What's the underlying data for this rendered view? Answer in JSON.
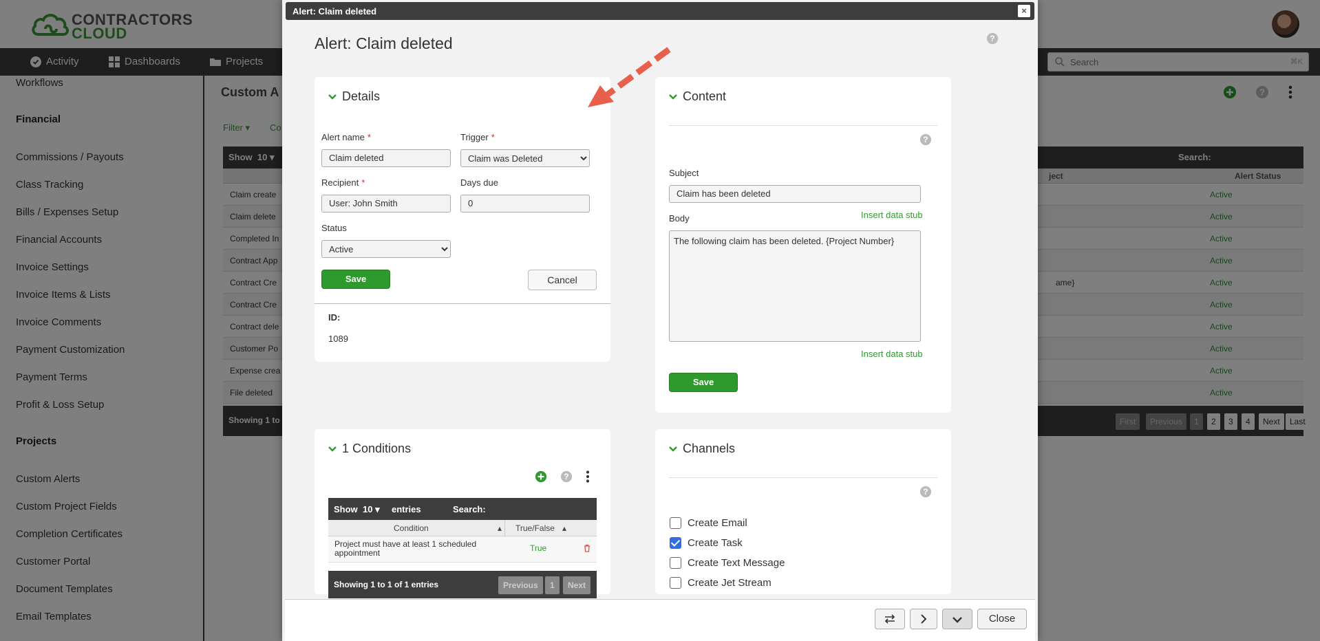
{
  "brand": {
    "line1": "CONTRACTORS",
    "line2": "CLOUD"
  },
  "nav": {
    "items": [
      {
        "label": "Activity",
        "icon": "check-circle-icon"
      },
      {
        "label": "Dashboards",
        "icon": "grid-icon"
      },
      {
        "label": "Projects",
        "icon": "folder-icon"
      }
    ],
    "search_placeholder": "Search",
    "search_shortcut": "⌘K"
  },
  "sidebar": {
    "top_item": "Workflows",
    "financial_heading": "Financial",
    "financial_items": [
      "Commissions / Payouts",
      "Class Tracking",
      "Bills / Expenses Setup",
      "Financial Accounts",
      "Invoice Settings",
      "Invoice Items & Lists",
      "Invoice Comments",
      "Payment Customization",
      "Payment Terms",
      "Profit & Loss Setup"
    ],
    "projects_heading": "Projects",
    "projects_items": [
      "Custom Alerts",
      "Custom Project Fields",
      "Completion Certificates",
      "Customer Portal",
      "Document Templates",
      "Email Templates"
    ]
  },
  "background_page": {
    "title": "Custom A",
    "filter_label": "Filter",
    "co_label": "Co",
    "show_label": "Show",
    "show_value": "10",
    "search_label": "Search:",
    "col_project": "ject",
    "col_status": "Alert Status",
    "rows": [
      {
        "name": "Claim create",
        "extra": "",
        "status": "Active"
      },
      {
        "name": "Claim delete",
        "extra": "",
        "status": "Active"
      },
      {
        "name": "Completed In",
        "extra": "",
        "status": "Active"
      },
      {
        "name": "Contract App",
        "extra": "",
        "status": "Active"
      },
      {
        "name": "Contract Cre",
        "extra": "ame}",
        "status": "Active"
      },
      {
        "name": "Contract Cre",
        "extra": "",
        "status": "Active"
      },
      {
        "name": "Contract dele",
        "extra": "",
        "status": "Active"
      },
      {
        "name": "Customer Po",
        "extra": "",
        "status": "Active"
      },
      {
        "name": "Expense crea",
        "extra": "",
        "status": "Active"
      },
      {
        "name": "File deleted",
        "extra": "",
        "status": "Active"
      }
    ],
    "footer_text": "Showing 1 to",
    "pagination": [
      "First",
      "Previous",
      "1",
      "2",
      "3",
      "4",
      "Next",
      "Last"
    ]
  },
  "modal": {
    "titlebar": "Alert: Claim deleted",
    "heading": "Alert: Claim deleted",
    "details": {
      "header": "Details",
      "alert_name_label": "Alert name",
      "alert_name_value": "Claim deleted",
      "trigger_label": "Trigger",
      "trigger_value": "Claim was Deleted",
      "recipient_label": "Recipient",
      "recipient_value": "User: John Smith",
      "days_due_label": "Days due",
      "days_due_value": "0",
      "status_label": "Status",
      "status_value": "Active",
      "save_label": "Save",
      "cancel_label": "Cancel",
      "id_label": "ID:",
      "id_value": "1089"
    },
    "content": {
      "header": "Content",
      "subject_label": "Subject",
      "subject_value": "Claim has been deleted",
      "insert_stub_label": "Insert data stub",
      "body_label": "Body",
      "body_value": "The following claim has been deleted. {Project Number}",
      "save_label": "Save"
    },
    "conditions": {
      "header": "1 Conditions",
      "show_label": "Show",
      "show_value": "10",
      "entries_label": "entries",
      "search_label": "Search:",
      "col_condition": "Condition",
      "col_truefalse": "True/False",
      "rows": [
        {
          "condition": "Project must have at least 1 scheduled appointment",
          "value": "True"
        }
      ],
      "footer_text": "Showing 1 to 1 of 1 entries",
      "pagination": [
        "Previous",
        "1",
        "Next"
      ]
    },
    "channels": {
      "header": "Channels",
      "items": [
        {
          "label": "Create Email",
          "checked": false
        },
        {
          "label": "Create Task",
          "checked": true
        },
        {
          "label": "Create Text Message",
          "checked": false
        },
        {
          "label": "Create Jet Stream",
          "checked": false
        }
      ]
    },
    "footer": {
      "close_label": "Close"
    }
  },
  "colors": {
    "accent_green": "#2e9a2e",
    "navbar": "#3d3d3d",
    "arrow": "#e8604c"
  }
}
